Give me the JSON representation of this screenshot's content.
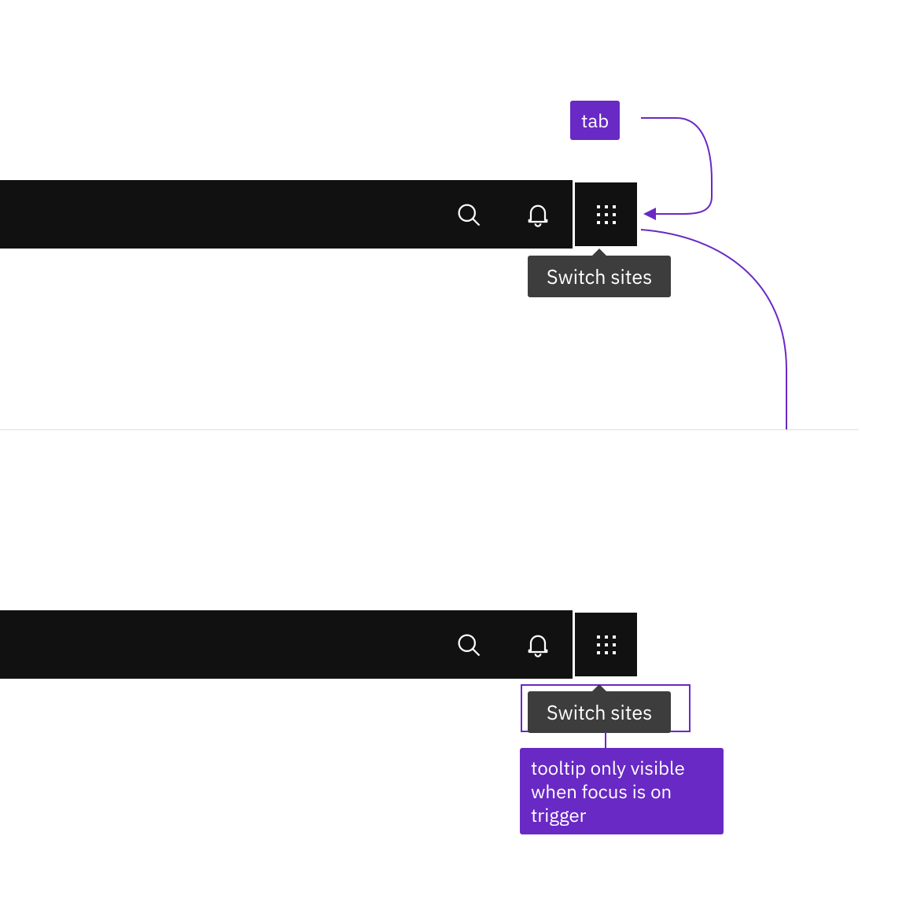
{
  "colors": {
    "accent": "#6929c4",
    "tooltip_bg": "#3d3d3d",
    "header_bg": "#111111"
  },
  "headers": {
    "first": {
      "tooltip": "Switch sites"
    },
    "second": {
      "tooltip": "Switch sites"
    }
  },
  "annotations": {
    "tab_label": "tab",
    "tooltip_note": "tooltip only visible when focus is on trigger"
  }
}
